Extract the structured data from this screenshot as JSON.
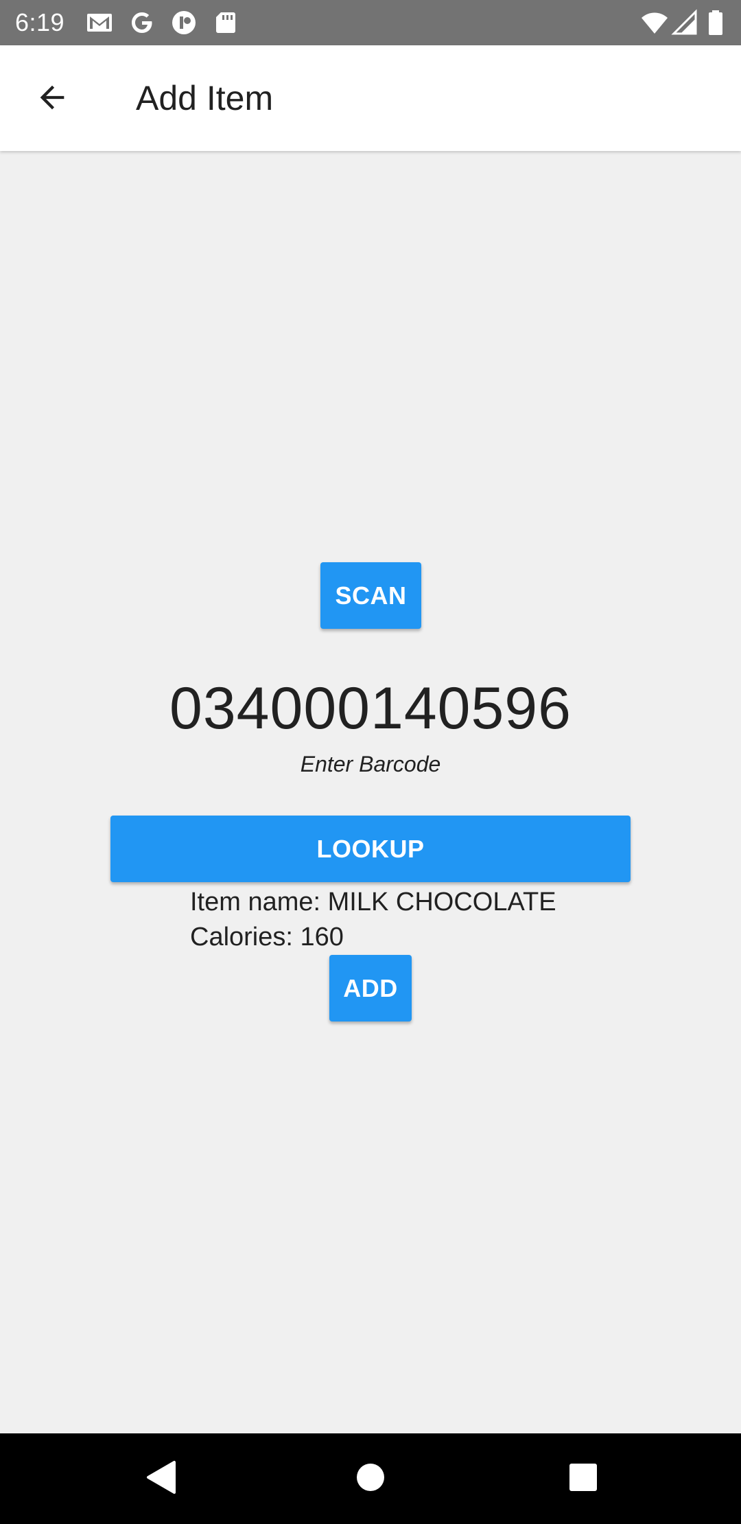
{
  "status_bar": {
    "time": "6:19",
    "icons": [
      "gmail-icon",
      "google-icon",
      "app-notification-icon",
      "sd-card-icon",
      "wifi-icon",
      "signal-icon",
      "battery-icon"
    ]
  },
  "app_bar": {
    "title": "Add Item",
    "back_icon": "arrow-left-icon"
  },
  "main": {
    "scan_label": "SCAN",
    "barcode_value": "034000140596",
    "barcode_hint": "Enter Barcode",
    "lookup_label": "LOOKUP",
    "item_name_line": "Item name: MILK CHOCOLATE",
    "calories_line": "Calories: 160",
    "add_label": "ADD"
  },
  "nav_bar": {
    "icons": [
      "back-triangle-icon",
      "home-circle-icon",
      "recents-square-icon"
    ]
  },
  "colors": {
    "accent": "#2196f3",
    "status_bar": "#737373",
    "background": "#f0f0f0",
    "app_bar": "#ffffff",
    "nav_bar": "#000000",
    "text": "#212121"
  }
}
